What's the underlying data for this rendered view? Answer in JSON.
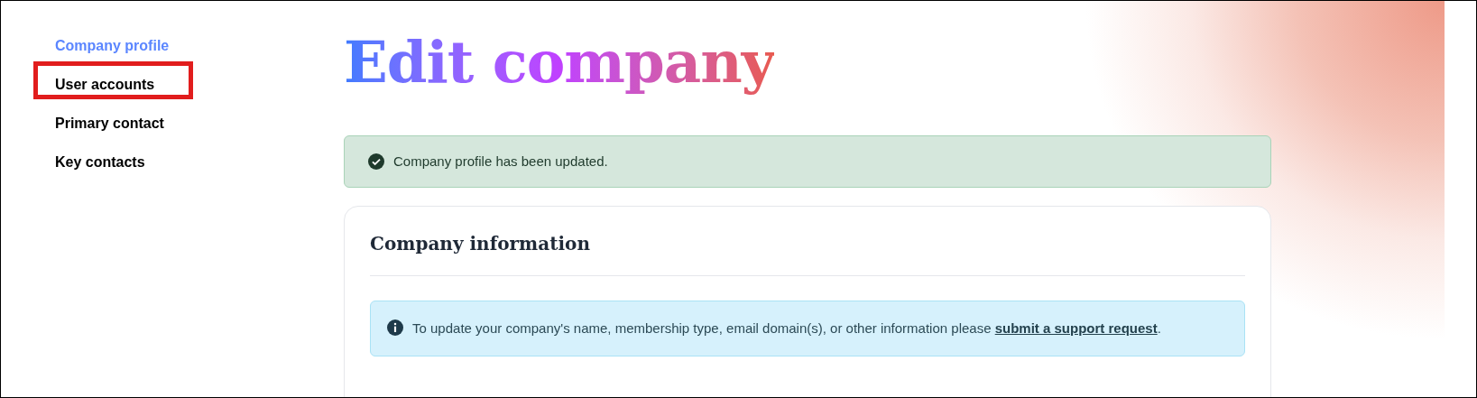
{
  "sidebar": {
    "items": [
      {
        "label": "Company profile",
        "selected": true,
        "highlighted": false
      },
      {
        "label": "User accounts",
        "selected": false,
        "highlighted": true
      },
      {
        "label": "Primary contact",
        "selected": false,
        "highlighted": false
      },
      {
        "label": "Key contacts",
        "selected": false,
        "highlighted": false
      }
    ]
  },
  "page_title": "Edit company",
  "alert": {
    "kind": "success",
    "message": "Company profile has been updated."
  },
  "card": {
    "title": "Company information",
    "info": {
      "text": "To update your company's name, membership type, email domain(s), or other information please ",
      "link": "submit a support request",
      "suffix": "."
    }
  }
}
